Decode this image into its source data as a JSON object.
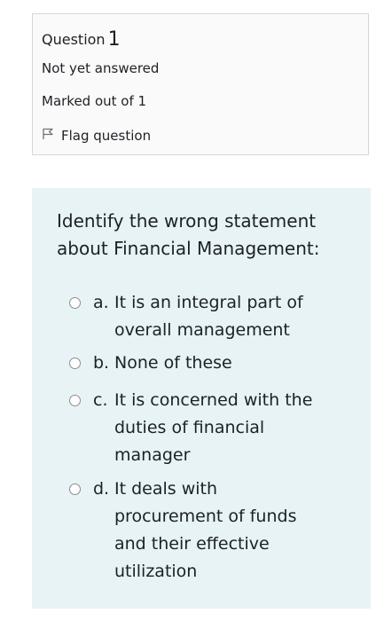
{
  "info": {
    "question_label": "Question",
    "question_number": "1",
    "state": "Not yet answered",
    "grade": "Marked out of 1",
    "flag_label": "Flag question"
  },
  "question": {
    "text": "Identify the wrong statement about Financial Management:",
    "options": [
      {
        "letter": "a.",
        "text": "It is an integral part of overall management"
      },
      {
        "letter": "b.",
        "text": "None of these"
      },
      {
        "letter": "c.",
        "text": "It is concerned with the duties of financial manager"
      },
      {
        "letter": "d.",
        "text": "It deals with procurement of funds and their effective utilization"
      }
    ]
  }
}
